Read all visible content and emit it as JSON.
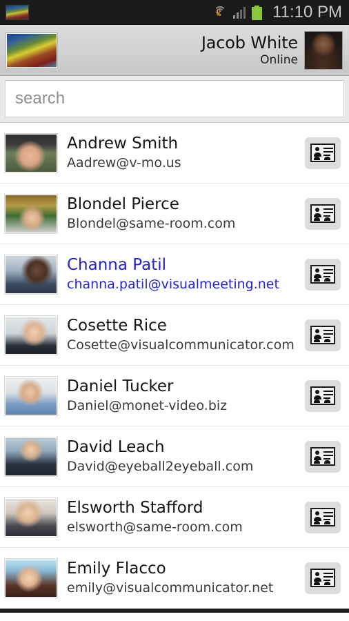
{
  "status_bar": {
    "time": "11:10 PM",
    "icons": [
      "app-thumbnail-icon",
      "wifi-download-icon",
      "cellular-signal-icon",
      "battery-full-icon"
    ]
  },
  "account_header": {
    "app_thumbnail_label": "app-thumbnail",
    "user_name": "Jacob White",
    "presence_status": "Online",
    "avatar_label": "jacob-white-avatar"
  },
  "search": {
    "placeholder": "search",
    "value": ""
  },
  "contacts": {
    "card_button_label": "contact-card",
    "items": [
      {
        "name": "Andrew Smith",
        "email": "Aadrew@v-mo.us",
        "selected": false
      },
      {
        "name": "Blondel Pierce",
        "email": "Blondel@same-room.com",
        "selected": false
      },
      {
        "name": "Channa Patil",
        "email": "channa.patil@visualmeeting.net",
        "selected": true
      },
      {
        "name": "Cosette Rice",
        "email": "Cosette@visualcommunicator.com",
        "selected": false
      },
      {
        "name": "Daniel Tucker",
        "email": "Daniel@monet-video.biz",
        "selected": false
      },
      {
        "name": "David Leach",
        "email": "David@eyeball2eyeball.com",
        "selected": false
      },
      {
        "name": "Elsworth Stafford",
        "email": "elsworth@same-room.com",
        "selected": false
      },
      {
        "name": "Emily Flacco",
        "email": "emily@visualcommunicator.net",
        "selected": false
      }
    ]
  },
  "colors": {
    "selected_text": "#2323c8",
    "status_bar_bg": "#1b1b1b",
    "header_bg": "#d2d2d2",
    "card_button_bg": "#dcdcdc",
    "row_divider": "#e4e4e4"
  }
}
